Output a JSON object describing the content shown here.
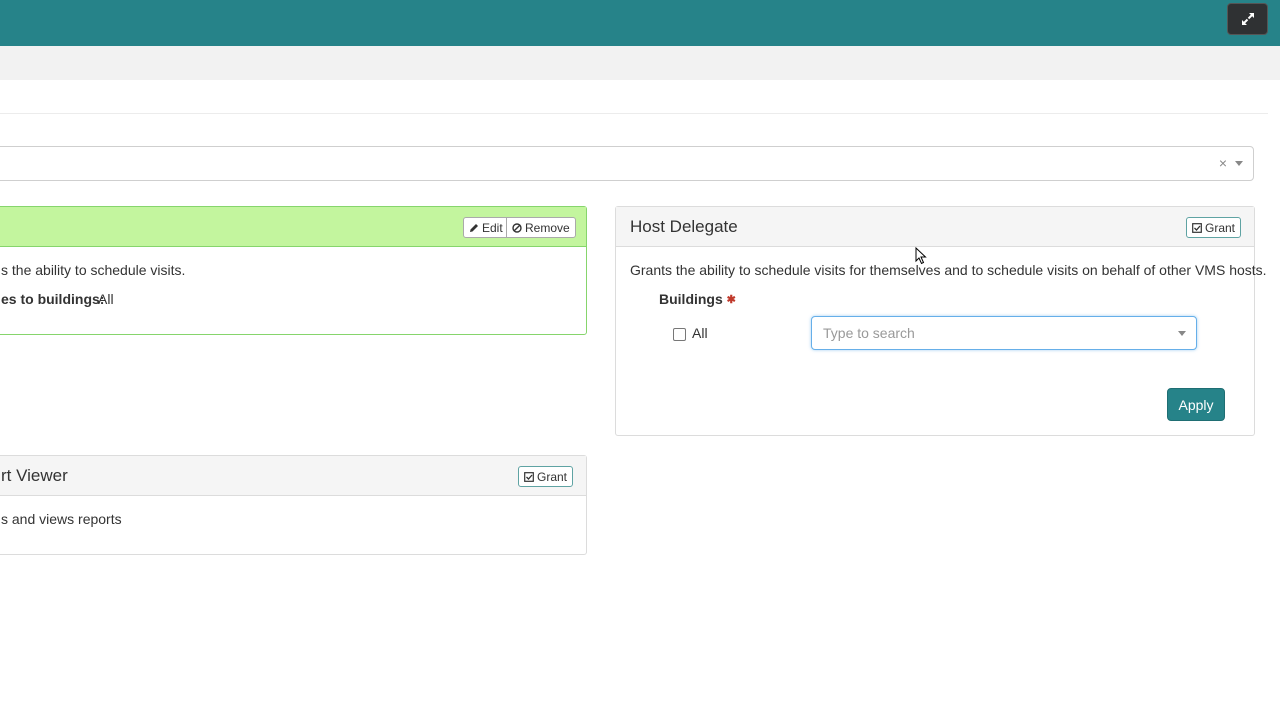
{
  "header": {
    "expand_icon": "expand-icon"
  },
  "role_select": {
    "clear_label": "×"
  },
  "panels": {
    "scheduler": {
      "edit_label": "Edit",
      "remove_label": "Remove",
      "description": "s the ability to schedule visits.",
      "access_label": "es to buildings:",
      "access_value": "All"
    },
    "host_delegate": {
      "title": "Host Delegate",
      "grant_label": "Grant",
      "description": "Grants the ability to schedule visits for themselves and to schedule visits on behalf of other VMS hosts.",
      "buildings_label": "Buildings",
      "required_mark": "✱",
      "all_label": "All",
      "search_placeholder": "Type to search",
      "apply_label": "Apply"
    },
    "report_viewer": {
      "title": "rt Viewer",
      "grant_label": "Grant",
      "description": "s and views reports"
    }
  },
  "colors": {
    "accent": "#268389",
    "assigned_header": "#c3f59e",
    "assigned_border": "#86d56c"
  }
}
